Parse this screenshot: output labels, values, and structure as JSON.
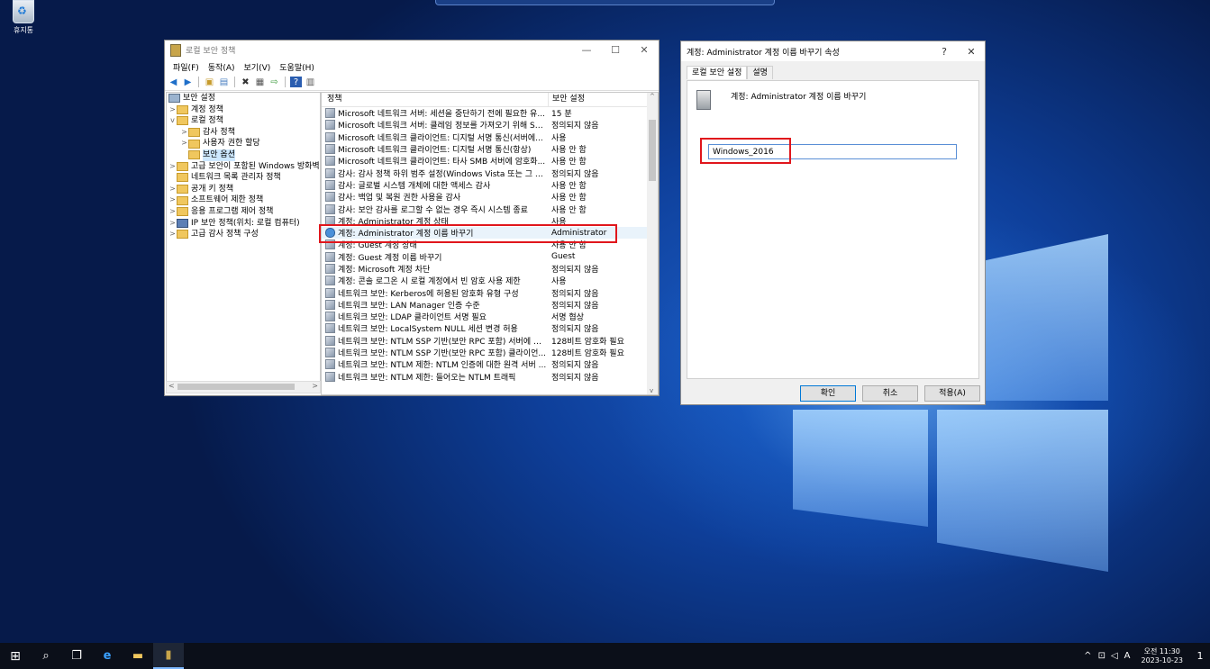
{
  "desktop": {
    "recycle_bin_label": "휴지통"
  },
  "mmc": {
    "title": "로컬 보안 정책",
    "menu": [
      "파일(F)",
      "동작(A)",
      "보기(V)",
      "도움말(H)"
    ],
    "tree": [
      {
        "label": "보안 설정",
        "level": 0,
        "expander": "",
        "selected": false
      },
      {
        "label": "계정 정책",
        "level": 1,
        "expander": ">",
        "selected": false
      },
      {
        "label": "로컬 정책",
        "level": 1,
        "expander": "v",
        "selected": false
      },
      {
        "label": "감사 정책",
        "level": 2,
        "expander": ">",
        "selected": false
      },
      {
        "label": "사용자 권한 할당",
        "level": 2,
        "expander": ">",
        "selected": false
      },
      {
        "label": "보안 옵션",
        "level": 2,
        "expander": "",
        "selected": true
      },
      {
        "label": "고급 보안이 포함된 Windows 방화벽",
        "level": 1,
        "expander": ">",
        "selected": false
      },
      {
        "label": "네트워크 목록 관리자 정책",
        "level": 1,
        "expander": "",
        "selected": false
      },
      {
        "label": "공개 키 정책",
        "level": 1,
        "expander": ">",
        "selected": false
      },
      {
        "label": "소프트웨어 제한 정책",
        "level": 1,
        "expander": ">",
        "selected": false
      },
      {
        "label": "응용 프로그램 제어 정책",
        "level": 1,
        "expander": ">",
        "selected": false
      },
      {
        "label": "IP 보안 정책(위치: 로컬 컴퓨터)",
        "level": 1,
        "expander": ">",
        "selected": false
      },
      {
        "label": "고급 감사 정책 구성",
        "level": 1,
        "expander": ">",
        "selected": false
      }
    ],
    "columns": {
      "policy": "정책",
      "setting": "보안 설정"
    },
    "rows": [
      {
        "policy": "Microsoft 네트워크 서버: 세션을 중단하기 전에 필요한 유...",
        "setting": "15 분"
      },
      {
        "policy": "Microsoft 네트워크 서버: 클레임 정보를 가져오기 위해 S4...",
        "setting": "정의되지 않음"
      },
      {
        "policy": "Microsoft 네트워크 클라이언트: 디지털 서명 통신(서버에...",
        "setting": "사용"
      },
      {
        "policy": "Microsoft 네트워크 클라이언트: 디지털 서명 통신(항상)",
        "setting": "사용 안 함"
      },
      {
        "policy": "Microsoft 네트워크 클라이언트: 타사 SMB 서버에 암호화...",
        "setting": "사용 안 함"
      },
      {
        "policy": "감사: 감사 정책 하위 범주 설정(Windows Vista 또는 그 이...",
        "setting": "정의되지 않음"
      },
      {
        "policy": "감사: 글로벌 시스템 개체에 대한 액세스 감사",
        "setting": "사용 안 함"
      },
      {
        "policy": "감사: 백업 및 복원 권한 사용을 감사",
        "setting": "사용 안 함"
      },
      {
        "policy": "감사: 보안 감사를 로그할 수 없는 경우 즉시 시스템 종료",
        "setting": "사용 안 함"
      },
      {
        "policy": "계정: Administrator 계정 상태",
        "setting": "사용"
      },
      {
        "policy": "계정: Administrator 계정 이름 바꾸기",
        "setting": "Administrator"
      },
      {
        "policy": "계정: Guest 계정 상태",
        "setting": "사용 안 함"
      },
      {
        "policy": "계정: Guest 계정 이름 바꾸기",
        "setting": "Guest"
      },
      {
        "policy": "계정: Microsoft 계정 차단",
        "setting": "정의되지 않음"
      },
      {
        "policy": "계정: 콘솔 로그온 시 로컬 계정에서 빈 암호 사용 제한",
        "setting": "사용"
      },
      {
        "policy": "네트워크 보안: Kerberos에 허용된 암호화 유형 구성",
        "setting": "정의되지 않음"
      },
      {
        "policy": "네트워크 보안: LAN Manager 인증 수준",
        "setting": "정의되지 않음"
      },
      {
        "policy": "네트워크 보안: LDAP 클라이언트 서명 필요",
        "setting": "서명 협상"
      },
      {
        "policy": "네트워크 보안: LocalSystem NULL 세션 변경 허용",
        "setting": "정의되지 않음"
      },
      {
        "policy": "네트워크 보안: NTLM SSP 기반(보안 RPC 포함) 서버에 대...",
        "setting": "128비트 암호화 필요"
      },
      {
        "policy": "네트워크 보안: NTLM SSP 기반(보안 RPC 포함) 클라이언...",
        "setting": "128비트 암호화 필요"
      },
      {
        "policy": "네트워크 보안: NTLM 제한: NTLM 인증에 대한 원격 서버 ...",
        "setting": "정의되지 않음"
      },
      {
        "policy": "네트워크 보안: NTLM 제한: 들어오는 NTLM 트래픽",
        "setting": "정의되지 않음"
      }
    ]
  },
  "dialog": {
    "title": "계정: Administrator 계정 이름 바꾸기 속성",
    "help": "?",
    "close": "✕",
    "tabs": [
      "로컬 보안 설정",
      "설명"
    ],
    "policy_name": "계정: Administrator 계정 이름 바꾸기",
    "input_value": "Windows_2016",
    "buttons": {
      "ok": "확인",
      "cancel": "취소",
      "apply": "적용(A)"
    }
  },
  "taskbar": {
    "clock_time": "오전 11:30",
    "clock_date": "2023-10-23",
    "ime": "A",
    "notification_count": "1"
  }
}
